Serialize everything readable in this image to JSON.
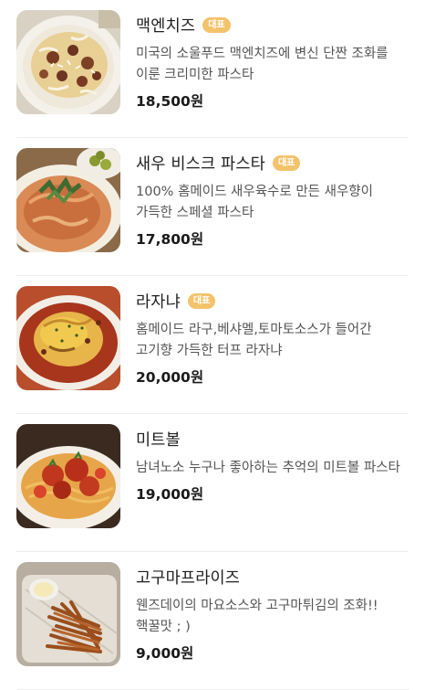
{
  "menu": {
    "items": [
      {
        "name": "맥엔치즈",
        "badge": "대표",
        "description": "미국의 소울푸드 맥엔치즈에 변신 단짠 조화를 이룬 크리미한 파스타",
        "price": "18,500원",
        "image": "mac-and-cheese-photo"
      },
      {
        "name": "새우 비스크 파스타",
        "badge": "대표",
        "description": "100% 홈메이드 새우육수로 만든 새우향이 가득한 스페셜 파스타",
        "price": "17,800원",
        "image": "shrimp-bisque-pasta-photo"
      },
      {
        "name": "라자냐",
        "badge": "대표",
        "description": "홈메이드 라구,베샤멜,토마토소스가 들어간 고기향 가득한 터프 라자냐",
        "price": "20,000원",
        "image": "lasagna-photo"
      },
      {
        "name": "미트볼",
        "badge": "",
        "description": "남녀노소 누구나 좋아하는 추억의 미트볼 파스타",
        "price": "19,000원",
        "image": "meatball-pasta-photo"
      },
      {
        "name": "고구마프라이즈",
        "badge": "",
        "description": "웬즈데이의 마요소스와 고구마튀김의 조화!! 핵꿀맛 ; )",
        "price": "9,000원",
        "image": "sweet-potato-fries-photo"
      }
    ],
    "colors": {
      "badge_bg": "#f3c36b",
      "badge_text": "#ffffff",
      "divider": "#ececec"
    }
  }
}
